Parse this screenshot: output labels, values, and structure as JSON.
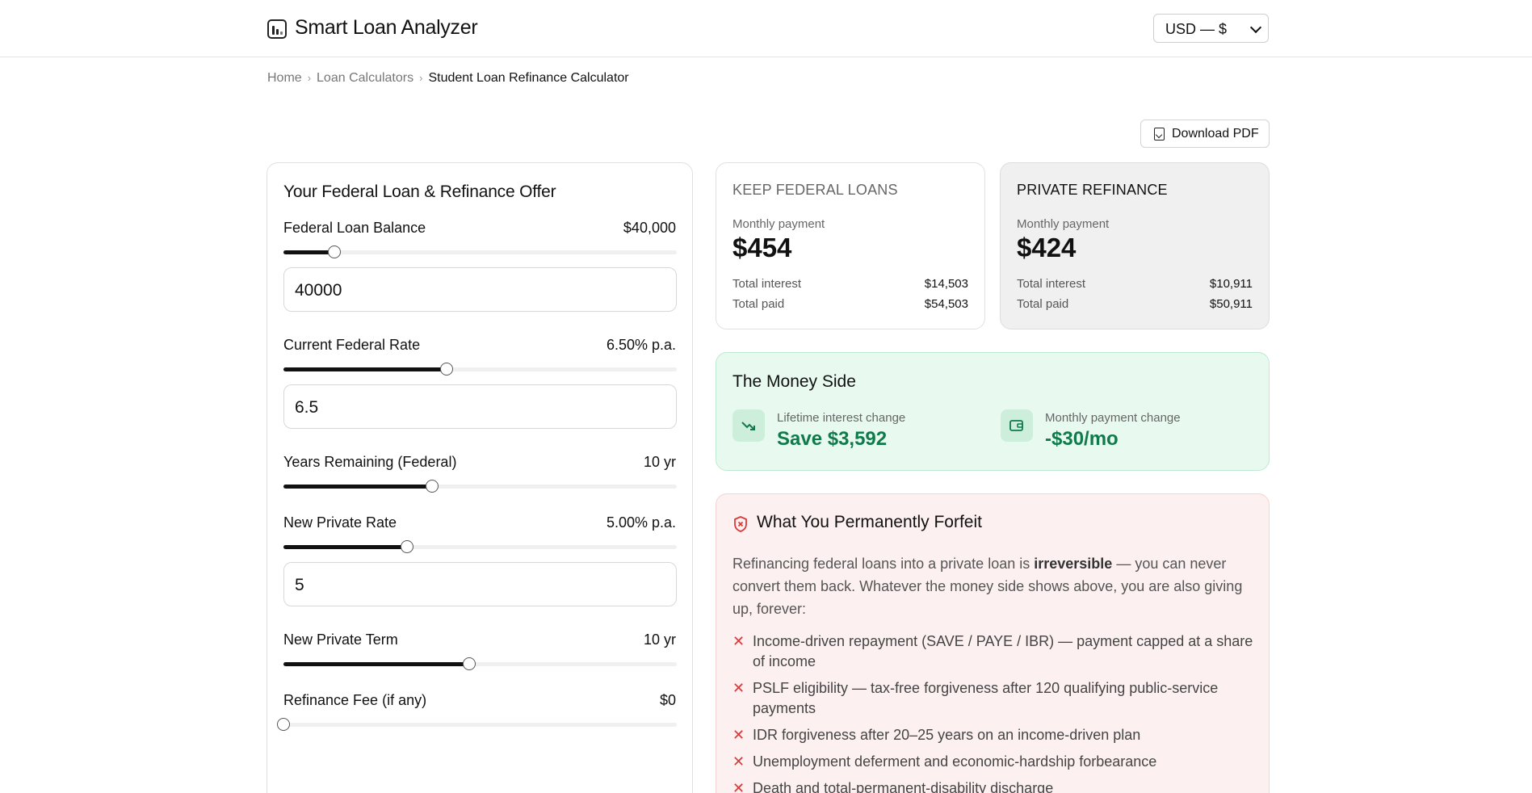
{
  "app": {
    "brand": "Smart Loan Analyzer",
    "currency": "USD — $"
  },
  "breadcrumb": [
    "Home",
    "Loan Calculators",
    "Student Loan Refinance Calculator"
  ],
  "toolbar": {
    "download_label": "Download PDF"
  },
  "inputs": {
    "title": "Your Federal Loan & Refinance Offer",
    "federal_balance": {
      "label": "Federal Loan Balance",
      "display": "$40,000",
      "value": "40000",
      "slider_fraction": 0.13
    },
    "federal_rate": {
      "label": "Current Federal Rate",
      "display": "6.50% p.a.",
      "value": "6.5",
      "slider_fraction": 0.415
    },
    "years_remaining": {
      "label": "Years Remaining (Federal)",
      "display": "10 yr",
      "slider_fraction": 0.378
    },
    "private_rate": {
      "label": "New Private Rate",
      "display": "5.00% p.a.",
      "value": "5",
      "slider_fraction": 0.315
    },
    "private_term": {
      "label": "New Private Term",
      "display": "10 yr",
      "slider_fraction": 0.473
    },
    "refinance_fee": {
      "label": "Refinance Fee (if any)",
      "display": "$0",
      "slider_fraction": 0.0
    }
  },
  "summary": {
    "keep": {
      "title": "KEEP FEDERAL LOANS",
      "monthly_label": "Monthly payment",
      "monthly_value": "$454",
      "interest_label": "Total interest",
      "interest_value": "$14,503",
      "paid_label": "Total paid",
      "paid_value": "$54,503"
    },
    "private": {
      "title": "PRIVATE REFINANCE",
      "monthly_label": "Monthly payment",
      "monthly_value": "$424",
      "interest_label": "Total interest",
      "interest_value": "$10,911",
      "paid_label": "Total paid",
      "paid_value": "$50,911"
    }
  },
  "money": {
    "title": "The Money Side",
    "interest_label": "Lifetime interest change",
    "interest_value": "Save $3,592",
    "monthly_label": "Monthly payment change",
    "monthly_value": "-$30/mo",
    "accent": "#0f7a4a"
  },
  "forfeit": {
    "title": "What You Permanently Forfeit",
    "intro_before": "Refinancing federal loans into a private loan is ",
    "intro_bold": "irreversible",
    "intro_after": " — you can never convert them back. Whatever the money side shows above, you are also giving up, forever:",
    "items": [
      "Income-driven repayment (SAVE / PAYE / IBR) — payment capped at a share of income",
      "PSLF eligibility — tax-free forgiveness after 120 qualifying public-service payments",
      "IDR forgiveness after 20–25 years on an income-driven plan",
      "Unemployment deferment and economic-hardship forbearance",
      "Death and total-permanent-disability discharge"
    ],
    "accent": "#d83a3a"
  }
}
